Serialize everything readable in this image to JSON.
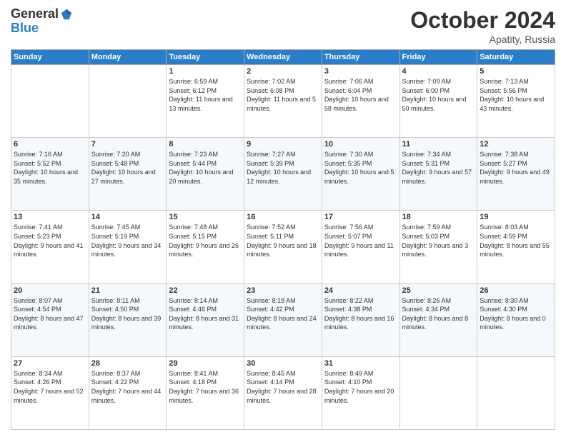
{
  "header": {
    "logo_general": "General",
    "logo_blue": "Blue",
    "month": "October 2024",
    "location": "Apatity, Russia"
  },
  "weekdays": [
    "Sunday",
    "Monday",
    "Tuesday",
    "Wednesday",
    "Thursday",
    "Friday",
    "Saturday"
  ],
  "weeks": [
    [
      {
        "day": "",
        "info": ""
      },
      {
        "day": "",
        "info": ""
      },
      {
        "day": "1",
        "info": "Sunrise: 6:59 AM\nSunset: 6:12 PM\nDaylight: 11 hours and 13 minutes."
      },
      {
        "day": "2",
        "info": "Sunrise: 7:02 AM\nSunset: 6:08 PM\nDaylight: 11 hours and 5 minutes."
      },
      {
        "day": "3",
        "info": "Sunrise: 7:06 AM\nSunset: 6:04 PM\nDaylight: 10 hours and 58 minutes."
      },
      {
        "day": "4",
        "info": "Sunrise: 7:09 AM\nSunset: 6:00 PM\nDaylight: 10 hours and 50 minutes."
      },
      {
        "day": "5",
        "info": "Sunrise: 7:13 AM\nSunset: 5:56 PM\nDaylight: 10 hours and 43 minutes."
      }
    ],
    [
      {
        "day": "6",
        "info": "Sunrise: 7:16 AM\nSunset: 5:52 PM\nDaylight: 10 hours and 35 minutes."
      },
      {
        "day": "7",
        "info": "Sunrise: 7:20 AM\nSunset: 5:48 PM\nDaylight: 10 hours and 27 minutes."
      },
      {
        "day": "8",
        "info": "Sunrise: 7:23 AM\nSunset: 5:44 PM\nDaylight: 10 hours and 20 minutes."
      },
      {
        "day": "9",
        "info": "Sunrise: 7:27 AM\nSunset: 5:39 PM\nDaylight: 10 hours and 12 minutes."
      },
      {
        "day": "10",
        "info": "Sunrise: 7:30 AM\nSunset: 5:35 PM\nDaylight: 10 hours and 5 minutes."
      },
      {
        "day": "11",
        "info": "Sunrise: 7:34 AM\nSunset: 5:31 PM\nDaylight: 9 hours and 57 minutes."
      },
      {
        "day": "12",
        "info": "Sunrise: 7:38 AM\nSunset: 5:27 PM\nDaylight: 9 hours and 49 minutes."
      }
    ],
    [
      {
        "day": "13",
        "info": "Sunrise: 7:41 AM\nSunset: 5:23 PM\nDaylight: 9 hours and 41 minutes."
      },
      {
        "day": "14",
        "info": "Sunrise: 7:45 AM\nSunset: 5:19 PM\nDaylight: 9 hours and 34 minutes."
      },
      {
        "day": "15",
        "info": "Sunrise: 7:48 AM\nSunset: 5:15 PM\nDaylight: 9 hours and 26 minutes."
      },
      {
        "day": "16",
        "info": "Sunrise: 7:52 AM\nSunset: 5:11 PM\nDaylight: 9 hours and 18 minutes."
      },
      {
        "day": "17",
        "info": "Sunrise: 7:56 AM\nSunset: 5:07 PM\nDaylight: 9 hours and 11 minutes."
      },
      {
        "day": "18",
        "info": "Sunrise: 7:59 AM\nSunset: 5:03 PM\nDaylight: 9 hours and 3 minutes."
      },
      {
        "day": "19",
        "info": "Sunrise: 8:03 AM\nSunset: 4:59 PM\nDaylight: 8 hours and 55 minutes."
      }
    ],
    [
      {
        "day": "20",
        "info": "Sunrise: 8:07 AM\nSunset: 4:54 PM\nDaylight: 8 hours and 47 minutes."
      },
      {
        "day": "21",
        "info": "Sunrise: 8:11 AM\nSunset: 4:50 PM\nDaylight: 8 hours and 39 minutes."
      },
      {
        "day": "22",
        "info": "Sunrise: 8:14 AM\nSunset: 4:46 PM\nDaylight: 8 hours and 31 minutes."
      },
      {
        "day": "23",
        "info": "Sunrise: 8:18 AM\nSunset: 4:42 PM\nDaylight: 8 hours and 24 minutes."
      },
      {
        "day": "24",
        "info": "Sunrise: 8:22 AM\nSunset: 4:38 PM\nDaylight: 8 hours and 16 minutes."
      },
      {
        "day": "25",
        "info": "Sunrise: 8:26 AM\nSunset: 4:34 PM\nDaylight: 8 hours and 8 minutes."
      },
      {
        "day": "26",
        "info": "Sunrise: 8:30 AM\nSunset: 4:30 PM\nDaylight: 8 hours and 0 minutes."
      }
    ],
    [
      {
        "day": "27",
        "info": "Sunrise: 8:34 AM\nSunset: 4:26 PM\nDaylight: 7 hours and 52 minutes."
      },
      {
        "day": "28",
        "info": "Sunrise: 8:37 AM\nSunset: 4:22 PM\nDaylight: 7 hours and 44 minutes."
      },
      {
        "day": "29",
        "info": "Sunrise: 8:41 AM\nSunset: 4:18 PM\nDaylight: 7 hours and 36 minutes."
      },
      {
        "day": "30",
        "info": "Sunrise: 8:45 AM\nSunset: 4:14 PM\nDaylight: 7 hours and 28 minutes."
      },
      {
        "day": "31",
        "info": "Sunrise: 8:49 AM\nSunset: 4:10 PM\nDaylight: 7 hours and 20 minutes."
      },
      {
        "day": "",
        "info": ""
      },
      {
        "day": "",
        "info": ""
      }
    ]
  ]
}
